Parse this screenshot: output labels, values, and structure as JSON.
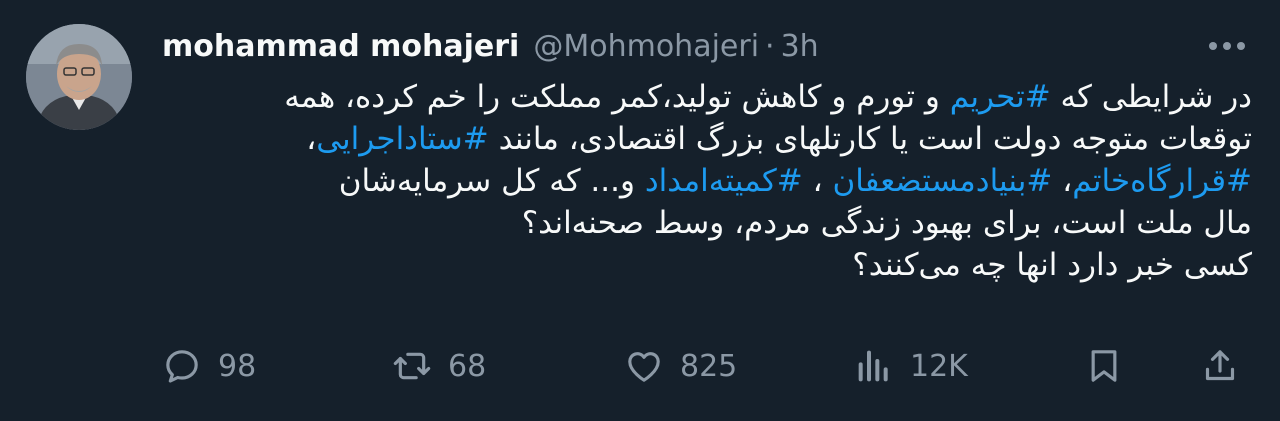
{
  "author": {
    "name": "mohammad mohajeri",
    "handle": "@Mohmohajeri",
    "separator": "·",
    "time": "3h"
  },
  "tweet": {
    "lines": [
      [
        {
          "t": "در شرایطی که ",
          "tag": false
        },
        {
          "t": "#تحریم",
          "tag": true
        },
        {
          "t": " و تورم و کاهش تولید،کمر مملکت را خم کرده، همه",
          "tag": false
        }
      ],
      [
        {
          "t": "توقعات متوجه دولت است یا  کارتلهای بزرگ اقتصادی، مانند ",
          "tag": false
        },
        {
          "t": "#ستاداجرایی",
          "tag": true
        },
        {
          "t": "،",
          "tag": false
        }
      ],
      [
        {
          "t": "#قرارگاه‌خاتم",
          "tag": true
        },
        {
          "t": "، ",
          "tag": false
        },
        {
          "t": "#بنیادمستضعفان",
          "tag": true
        },
        {
          "t": " ، ",
          "tag": false
        },
        {
          "t": "#کمیته‌امداد",
          "tag": true
        },
        {
          "t": " و... که کل سرمایه‌شان",
          "tag": false
        }
      ],
      [
        {
          "t": "مال ملت است، برای بهبود زندگی مردم، وسط صحنه‌اند؟",
          "tag": false
        }
      ],
      [
        {
          "t": "کسی خبر دارد انها چه می‌کنند؟",
          "tag": false
        }
      ]
    ]
  },
  "actions": {
    "replies": "98",
    "retweets": "68",
    "likes": "825",
    "views": "12K"
  },
  "icons": {
    "avatar": "profile-photo",
    "more": "more-horizontal-icon",
    "reply": "reply-icon",
    "retweet": "retweet-icon",
    "like": "heart-icon",
    "views": "views-chart-icon",
    "bookmark": "bookmark-icon",
    "share": "share-icon"
  },
  "colors": {
    "background": "#15202b",
    "text": "#f7f9f9",
    "secondary": "#8b98a5",
    "hashtag": "#1d9bf0"
  }
}
